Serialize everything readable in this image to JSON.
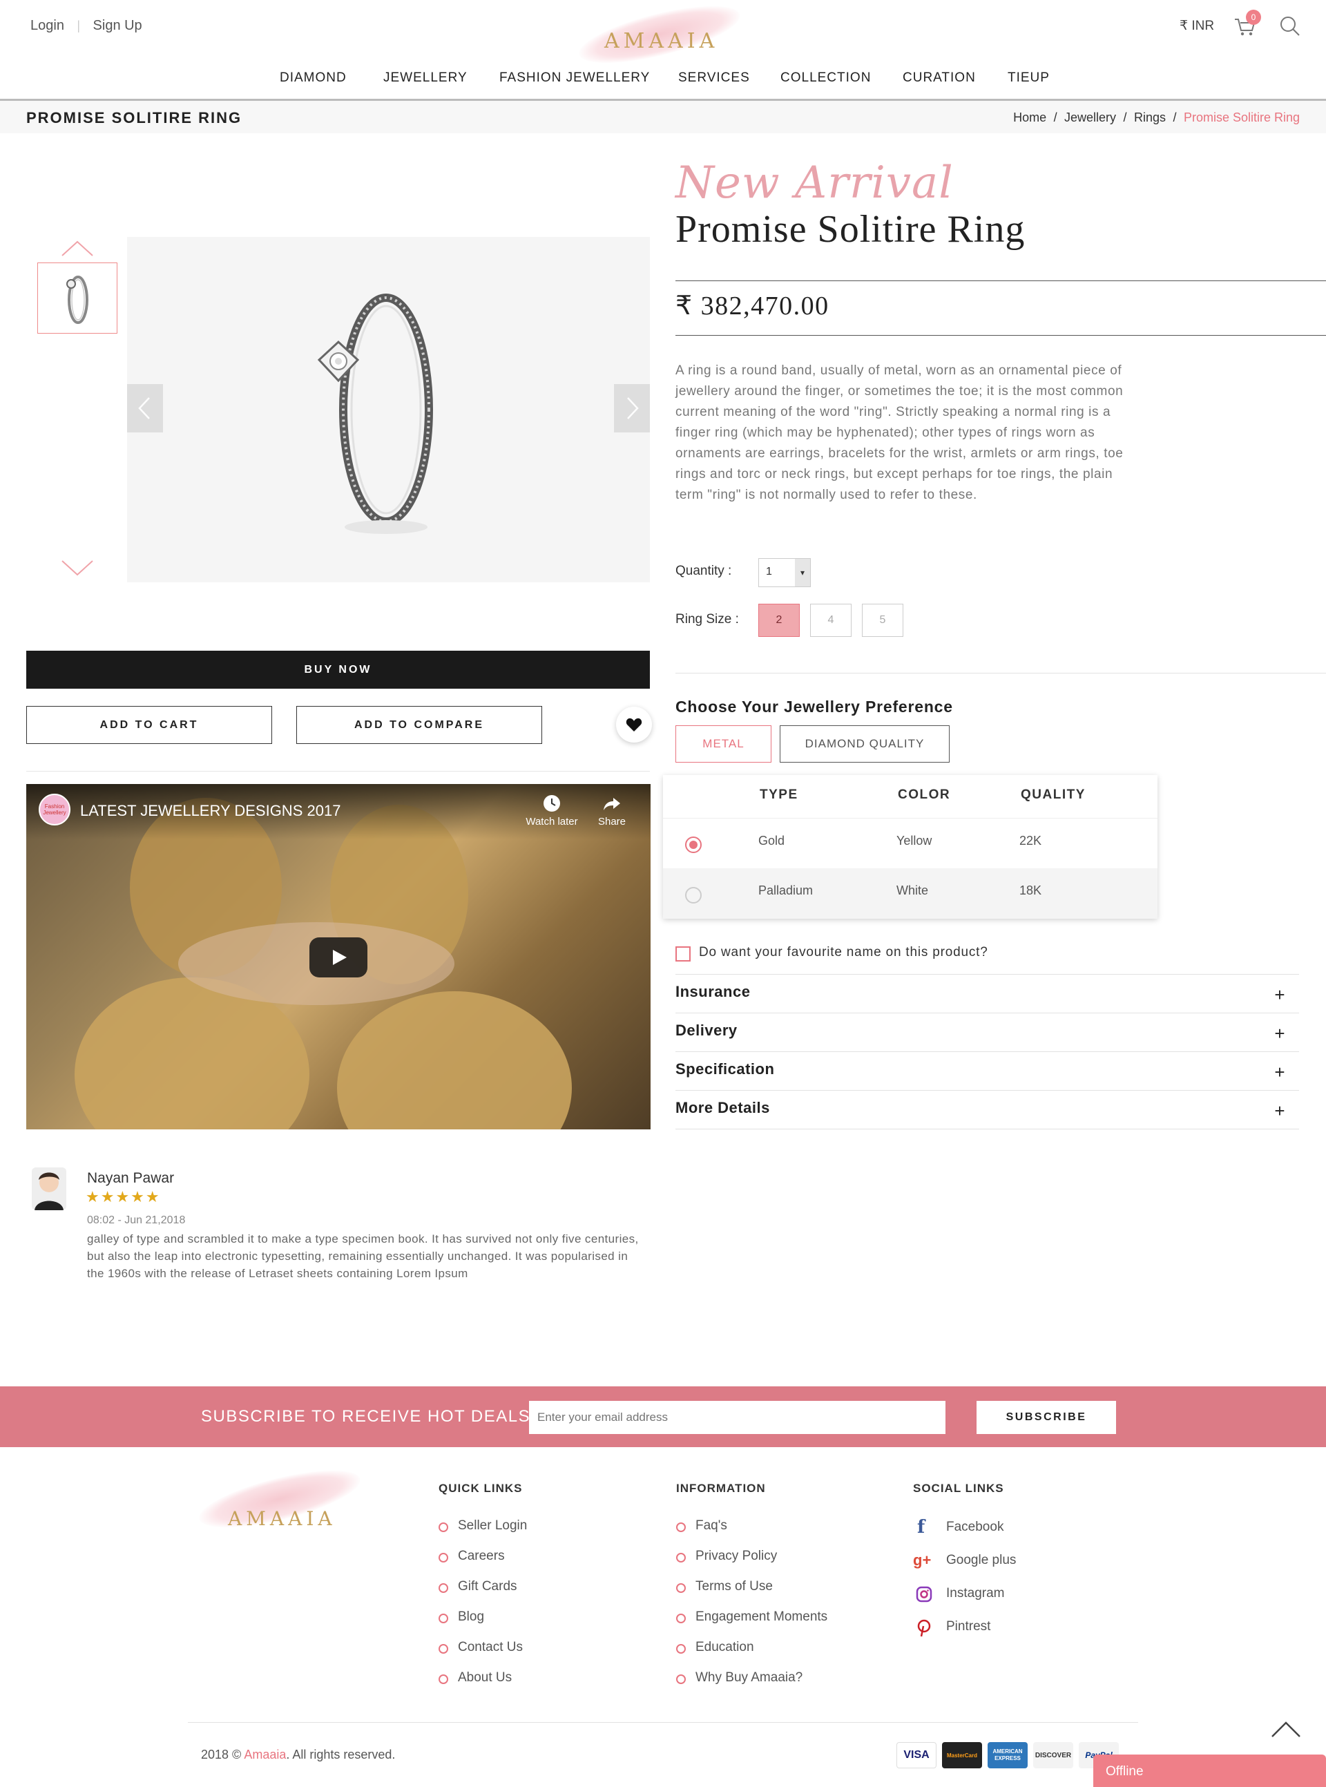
{
  "header": {
    "login": "Login",
    "signup": "Sign Up",
    "logo": "AMAAIA",
    "currency": "₹ INR",
    "cart_count": "0"
  },
  "nav": [
    "DIAMOND",
    "JEWELLERY",
    "FASHION JEWELLERY",
    "SERVICES",
    "COLLECTION",
    "CURATION",
    "TIEUP"
  ],
  "breadcrumb": {
    "page_title": "PROMISE SOLITIRE RING",
    "items": [
      "Home",
      "Jewellery",
      "Rings"
    ],
    "current": "Promise Solitire Ring",
    "sep": "/"
  },
  "product": {
    "badge": "New Arrival",
    "name": "Promise Solitire Ring",
    "price": "₹ 382,470.00",
    "description": "A ring is a round band, usually of metal, worn as an ornamental piece of jewellery around the finger, or sometimes the toe; it is the most common current meaning of the word \"ring\". Strictly speaking a normal ring is a finger ring (which may be hyphenated); other types of rings worn as ornaments are earrings, bracelets for the wrist, armlets or arm rings, toe rings and torc or neck rings, but except perhaps for toe rings, the plain term \"ring\" is not normally used to refer to these.",
    "quantity_label": "Quantity :",
    "quantity_value": "1",
    "ring_size_label": "Ring Size :",
    "ring_sizes": [
      "2",
      "4",
      "5"
    ],
    "selected_size": "2",
    "buy_now": "BUY NOW",
    "add_to_cart": "ADD TO CART",
    "add_to_compare": "ADD TO COMPARE"
  },
  "preference": {
    "title": "Choose Your Jewellery Preference",
    "tabs": [
      "METAL",
      "DIAMOND QUALITY"
    ],
    "active_tab": "METAL",
    "columns": [
      "TYPE",
      "COLOR",
      "QUALITY"
    ],
    "rows": [
      {
        "type": "Gold",
        "color": "Yellow",
        "quality": "22K",
        "selected": true
      },
      {
        "type": "Palladium",
        "color": "White",
        "quality": "18K",
        "selected": false
      }
    ],
    "name_option": "Do want your favourite name on this product?"
  },
  "accordion": [
    "Insurance",
    "Delivery",
    "Specification",
    "More Details"
  ],
  "video": {
    "title": "LATEST JEWELLERY DESIGNS 2017",
    "channel_badge": "Fashion Jewellery",
    "watch_later": "Watch later",
    "share": "Share"
  },
  "review": {
    "name": "Nayan Pawar",
    "rating": 5,
    "stars": "★★★★★",
    "date": "08:02 - Jun 21,2018",
    "text": "galley of type and scrambled it to make a type specimen book. It has survived not only five centuries, but also the leap into electronic typesetting, remaining essentially unchanged. It was popularised in the 1960s with the release of Letraset sheets containing Lorem Ipsum"
  },
  "subscribe": {
    "title": "SUBSCRIBE TO RECEIVE HOT DEALS",
    "placeholder": "Enter your email address",
    "button": "SUBSCRIBE"
  },
  "footer": {
    "logo": "AMAAIA",
    "quick_links_title": "QUICK LINKS",
    "quick_links": [
      "Seller Login",
      "Careers",
      "Gift Cards",
      "Blog",
      "Contact Us",
      "About Us"
    ],
    "information_title": "INFORMATION",
    "information": [
      "Faq's",
      "Privacy Policy",
      "Terms of Use",
      "Engagement Moments",
      "Education",
      "Why Buy Amaaia?"
    ],
    "social_title": "SOCIAL LINKS",
    "social": [
      "Facebook",
      "Google plus",
      "Instagram",
      "Pintrest"
    ],
    "copyright_prefix": "2018 ©",
    "copyright_brand": "Amaaia",
    "copyright_suffix": ". All rights reserved.",
    "payments": [
      "VISA",
      "MasterCard",
      "AMERICAN EXPRESS",
      "DISCOVER",
      "PayPal"
    ],
    "chat": "Offline"
  },
  "colors": {
    "accent": "#e8747f",
    "gold": "#c6a15b",
    "subscribe_bg": "#dc7b86"
  }
}
